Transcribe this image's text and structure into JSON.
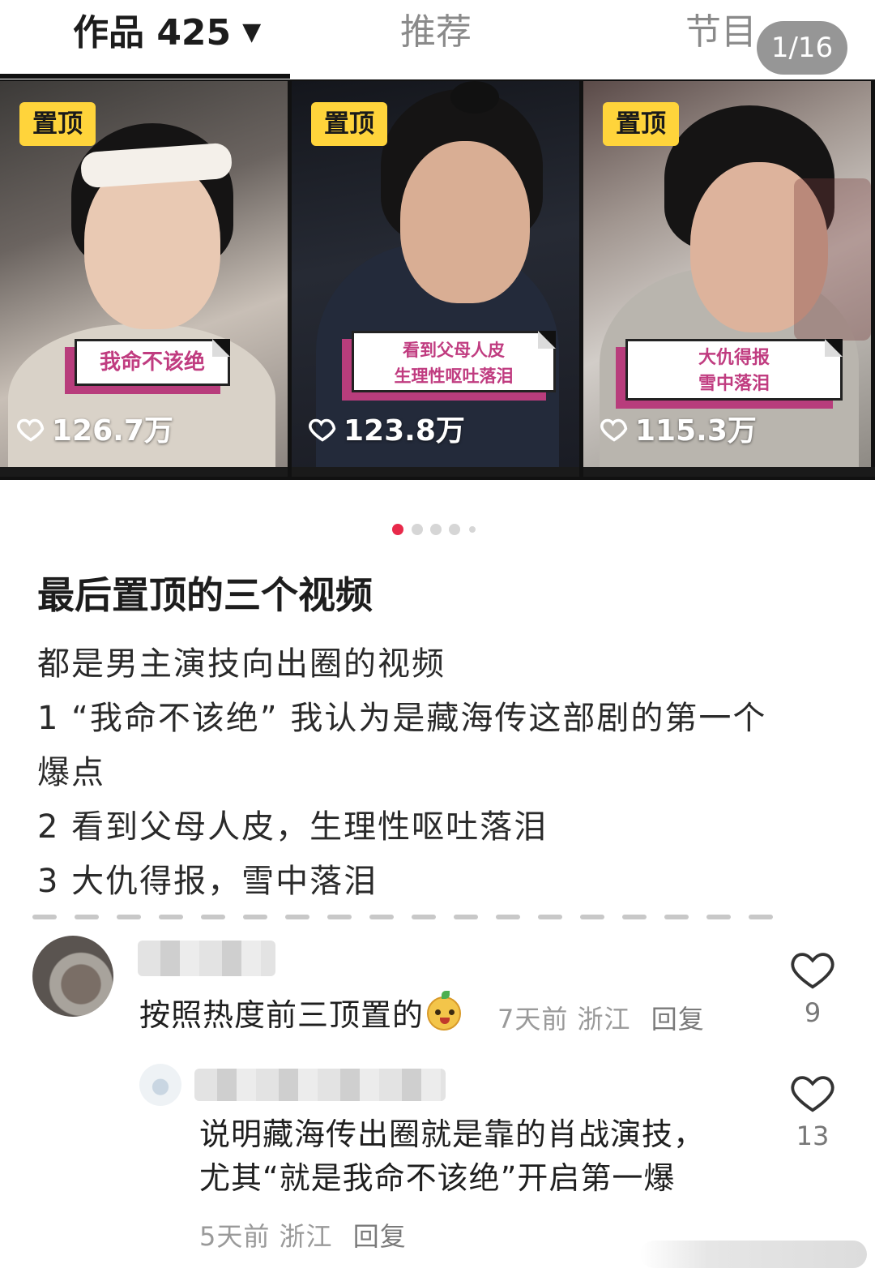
{
  "tabs": {
    "works_label": "作品 425",
    "works_caret": "▼",
    "recommend_label": "推荐",
    "program_label": "节目",
    "page_indicator": "1/16"
  },
  "videos": [
    {
      "badge": "置顶",
      "caption_lines": [
        "我命不该绝"
      ],
      "likes": "126.7万"
    },
    {
      "badge": "置顶",
      "caption_lines": [
        "看到父母人皮",
        "生理性呕吐落泪"
      ],
      "likes": "123.8万"
    },
    {
      "badge": "置顶",
      "caption_lines": [
        "大仇得报",
        "雪中落泪"
      ],
      "likes": "115.3万"
    }
  ],
  "carousel": {
    "count": 5,
    "active_index": 0,
    "active_color": "#e8294a"
  },
  "post": {
    "title": "最后置顶的三个视频",
    "lines": [
      "都是男主演技向出圈的视频",
      "1 “我命不该绝” 我认为是藏海传这部剧的第一个",
      "爆点",
      "2 看到父母人皮，生理性呕吐落泪",
      "3 大仇得报，雪中落泪"
    ]
  },
  "comments": [
    {
      "text": "按照热度前三顶置的",
      "emoji_icon": "cartoon-face-emoji",
      "time": "7天前",
      "location": "浙江",
      "reply_label": "回复",
      "like_count": "9"
    },
    {
      "text_lines": [
        "说明藏海传出圈就是靠的肖战演技，",
        "尤其“就是我命不该绝”开启第一爆"
      ],
      "time": "5天前",
      "location": "浙江",
      "reply_label": "回复",
      "like_count": "13"
    }
  ],
  "colors": {
    "badge_bg": "#ffd43b",
    "caption_text": "#c03c80",
    "caption_accent": "#b83d7c"
  }
}
